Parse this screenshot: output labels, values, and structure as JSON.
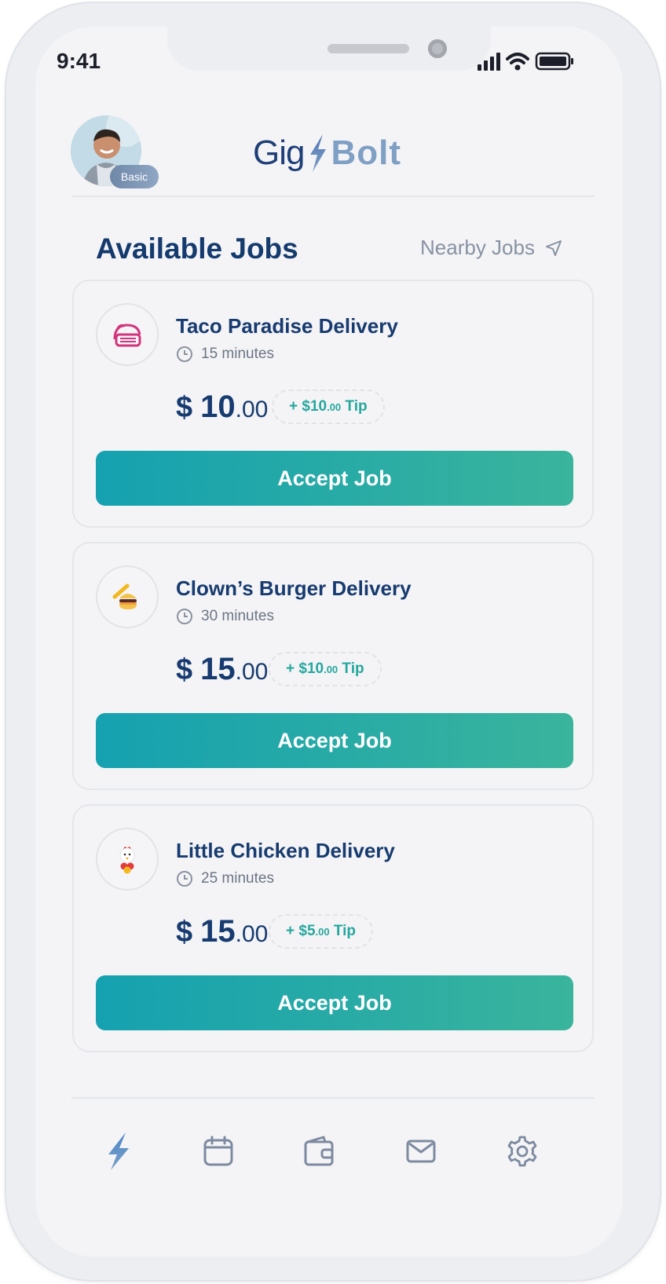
{
  "status_bar": {
    "time": "9:41"
  },
  "profile": {
    "badge": "Basic"
  },
  "brand": {
    "name_part1": "Gig",
    "name_part2": "Bolt"
  },
  "header": {
    "title": "Available Jobs",
    "nearby_label": "Nearby Jobs"
  },
  "jobs": [
    {
      "title": "Taco Paradise Delivery",
      "duration": "15 minutes",
      "currency": "$",
      "price_main": "10",
      "price_decimal": ".00",
      "tip_prefix": "+ $10",
      "tip_decimal": ".00",
      "tip_suffix": " Tip",
      "button": "Accept Job",
      "icon": "taco-icon"
    },
    {
      "title": "Clown’s Burger Delivery",
      "duration": "30 minutes",
      "currency": "$",
      "price_main": "15",
      "price_decimal": ".00",
      "tip_prefix": "+ $10",
      "tip_decimal": ".00",
      "tip_suffix": " Tip",
      "button": "Accept Job",
      "icon": "burger-icon"
    },
    {
      "title": "Little Chicken Delivery",
      "duration": "25 minutes",
      "currency": "$",
      "price_main": "15",
      "price_decimal": ".00",
      "tip_prefix": "+ $5",
      "tip_decimal": ".00",
      "tip_suffix": " Tip",
      "button": "Accept Job",
      "icon": "chicken-icon"
    }
  ],
  "bottom_nav": [
    {
      "name": "jobs",
      "icon": "bolt-icon",
      "active": true
    },
    {
      "name": "schedule",
      "icon": "calendar-icon",
      "active": false
    },
    {
      "name": "wallet",
      "icon": "wallet-icon",
      "active": false
    },
    {
      "name": "messages",
      "icon": "mail-icon",
      "active": false
    },
    {
      "name": "settings",
      "icon": "gear-icon",
      "active": false
    }
  ],
  "colors": {
    "primary_text": "#173b70",
    "accent_start": "#15a1b0",
    "accent_end": "#3ab49c",
    "tip_text": "#26a79e",
    "muted": "#8792a3"
  }
}
